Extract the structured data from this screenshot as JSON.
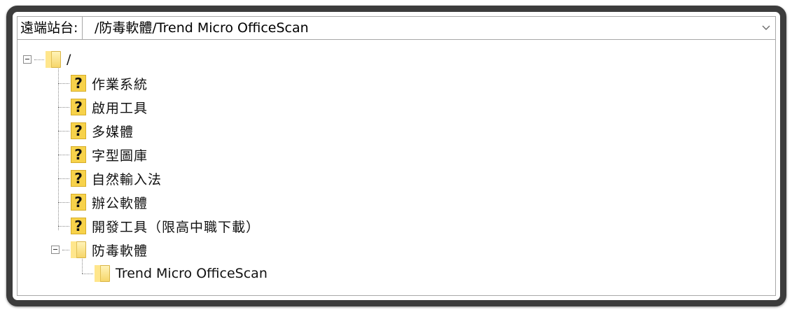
{
  "address_bar": {
    "label": "遠端站台:",
    "path": "/防毒軟體/Trend Micro OfficeScan"
  },
  "tree": {
    "root": {
      "label": "/",
      "icon": "folder-icon"
    },
    "children": [
      {
        "label": "作業系統",
        "icon": "question-icon"
      },
      {
        "label": "啟用工具",
        "icon": "question-icon"
      },
      {
        "label": "多媒體",
        "icon": "question-icon"
      },
      {
        "label": "字型圖庫",
        "icon": "question-icon"
      },
      {
        "label": "自然輸入法",
        "icon": "question-icon"
      },
      {
        "label": "辦公軟體",
        "icon": "question-icon"
      },
      {
        "label": "開發工具（限高中職下載）",
        "icon": "question-icon"
      }
    ],
    "expanded": {
      "label": "防毒軟體",
      "icon": "folder-icon",
      "child": {
        "label": "Trend Micro OfficeScan",
        "icon": "folder-icon"
      }
    }
  },
  "colors": {
    "frame": "#3c3c3c",
    "folder": "#f6d66a",
    "question_icon": "#f7d24a"
  }
}
